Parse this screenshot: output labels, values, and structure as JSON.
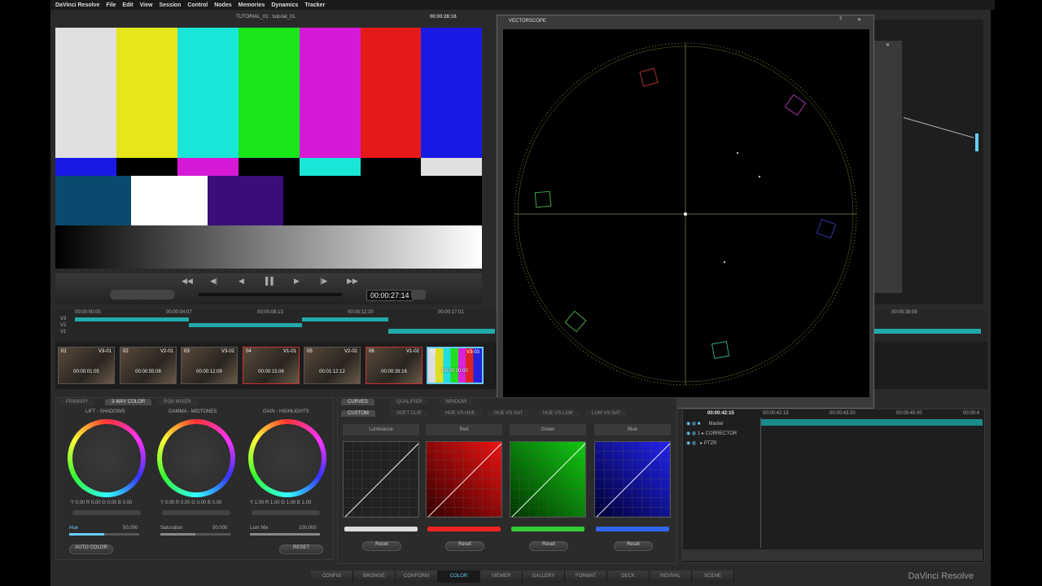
{
  "menu": [
    "DaVinci Resolve",
    "File",
    "Edit",
    "View",
    "Session",
    "Control",
    "Nodes",
    "Memories",
    "Dynamics",
    "Tracker"
  ],
  "viewer": {
    "clip_name": "TUTORIAL_01 : tutorial_01",
    "timecode_top": "00:00:28:16",
    "timecode": "00:00:27:14"
  },
  "vectorscope": {
    "title": "VECTORSCOPE",
    "help": "?",
    "close": "✕"
  },
  "node_close": "✕",
  "timeline": {
    "ruler": [
      "00:00:00:00",
      "00:00:04:07",
      "00:00:08:13",
      "00:00:12:20",
      "00:00:17:01",
      "00:00:38:09"
    ],
    "tracks": [
      "V3",
      "V2",
      "V1"
    ]
  },
  "thumbs": [
    {
      "num": "01",
      "name": "V3-01",
      "tc": "00:00:01:05"
    },
    {
      "num": "02",
      "name": "V2-01",
      "tc": "00:00:55:08"
    },
    {
      "num": "03",
      "name": "V3-02",
      "tc": "00:00:12:09"
    },
    {
      "num": "04",
      "name": "V1-01",
      "tc": "00:00:15:06"
    },
    {
      "num": "05",
      "name": "V2-02",
      "tc": "00:01:12:12"
    },
    {
      "num": "06",
      "name": "V1-02",
      "tc": "00:00:28:16"
    },
    {
      "num": "07",
      "name": "V3-03",
      "tc": "00:00:00:00"
    }
  ],
  "color_tabs": [
    "PRIMARY",
    "3-WAY COLOR",
    "RGB MIXER"
  ],
  "wheels": [
    {
      "label": "LIFT - SHADOWS",
      "values": "Y 0.00  R 0.00  G 0.00  B 0.00"
    },
    {
      "label": "GAMMA - MIDTONES",
      "values": "Y 0.00  R 0.00  G 0.00  B 0.00"
    },
    {
      "label": "GAIN - HIGHLIGHTS",
      "values": "Y 1.00  R 1.00  G 1.00  B 1.00"
    }
  ],
  "sliders": [
    {
      "label": "Hue",
      "value": "50.000"
    },
    {
      "label": "Saturation",
      "value": "50.000"
    },
    {
      "label": "Lum Mix",
      "value": "100.000"
    }
  ],
  "buttons": {
    "auto_color": "AUTO COLOR",
    "reset": "RESET"
  },
  "curve_tabs": [
    "CURVES",
    "QUALIFIER",
    "WINDOW"
  ],
  "curve_subtabs": [
    "CUSTOM",
    "SOFT CLIP",
    "HUE VS HUE",
    "HUE VS SAT",
    "HUE VS LUM",
    "LUM VS SAT"
  ],
  "curves": [
    {
      "label": "Luminance",
      "reset": "Reset",
      "color": "#ddd"
    },
    {
      "label": "Red",
      "reset": "Reset",
      "color": "#e22"
    },
    {
      "label": "Green",
      "reset": "Reset",
      "color": "#3c3"
    },
    {
      "label": "Blue",
      "reset": "Reset",
      "color": "#36e"
    }
  ],
  "keyframe": {
    "ruler": [
      "00:00:42:15",
      "00:00:42:15",
      "00:00:43:20",
      "00:00:45:00",
      "00:00:4"
    ],
    "rows": [
      "Master",
      "CORRECTOR",
      "PTZR"
    ],
    "row_num": "1"
  },
  "bottom_tabs": [
    "CONFIG",
    "BROWSE",
    "CONFORM",
    "COLOR",
    "VIEWER",
    "GALLERY",
    "FORMAT",
    "DECK",
    "REVIVAL",
    "SCENE"
  ],
  "brand": "DaVinci Resolve"
}
